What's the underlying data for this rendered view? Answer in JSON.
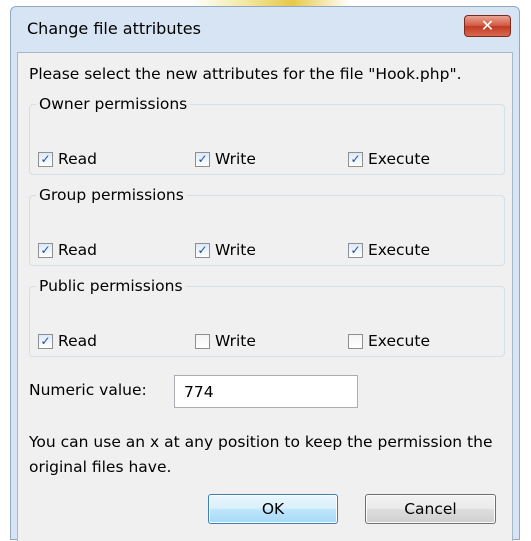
{
  "dialog": {
    "title": "Change file attributes",
    "close_icon": "close-icon",
    "prompt": "Please select the new attributes for the file \"Hook.php\".",
    "groups": [
      {
        "legend": "Owner permissions",
        "options": [
          {
            "label": "Read",
            "checked": true
          },
          {
            "label": "Write",
            "checked": true
          },
          {
            "label": "Execute",
            "checked": true
          }
        ]
      },
      {
        "legend": "Group permissions",
        "options": [
          {
            "label": "Read",
            "checked": true
          },
          {
            "label": "Write",
            "checked": true
          },
          {
            "label": "Execute",
            "checked": true
          }
        ]
      },
      {
        "legend": "Public permissions",
        "options": [
          {
            "label": "Read",
            "checked": true
          },
          {
            "label": "Write",
            "checked": false
          },
          {
            "label": "Execute",
            "checked": false
          }
        ]
      }
    ],
    "numeric_label": "Numeric value:",
    "numeric_value": "774",
    "hint": "You can use an x at any position to keep the permission the original files have.",
    "ok_label": "OK",
    "cancel_label": "Cancel"
  },
  "colors": {
    "dialog_frame": "#d6e4f3",
    "client_bg": "#f0f0f0",
    "close_button": "#c23a22",
    "ok_border": "#3c7fb1",
    "check_mark": "#1f4fa0"
  }
}
